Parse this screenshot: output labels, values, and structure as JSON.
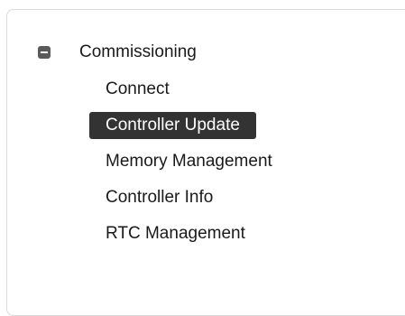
{
  "tree": {
    "root": {
      "label": "Commissioning",
      "expanded": true,
      "toggle_icon": "collapse-minus-icon"
    },
    "children": [
      {
        "label": "Connect",
        "selected": false
      },
      {
        "label": "Controller Update",
        "selected": true
      },
      {
        "label": "Memory Management",
        "selected": false
      },
      {
        "label": "Controller Info",
        "selected": false
      },
      {
        "label": "RTC Management",
        "selected": false
      }
    ]
  },
  "colors": {
    "selected_background": "#333333",
    "selected_text": "#ffffff",
    "text": "#1a1a1a",
    "border": "#d9d9d9"
  }
}
